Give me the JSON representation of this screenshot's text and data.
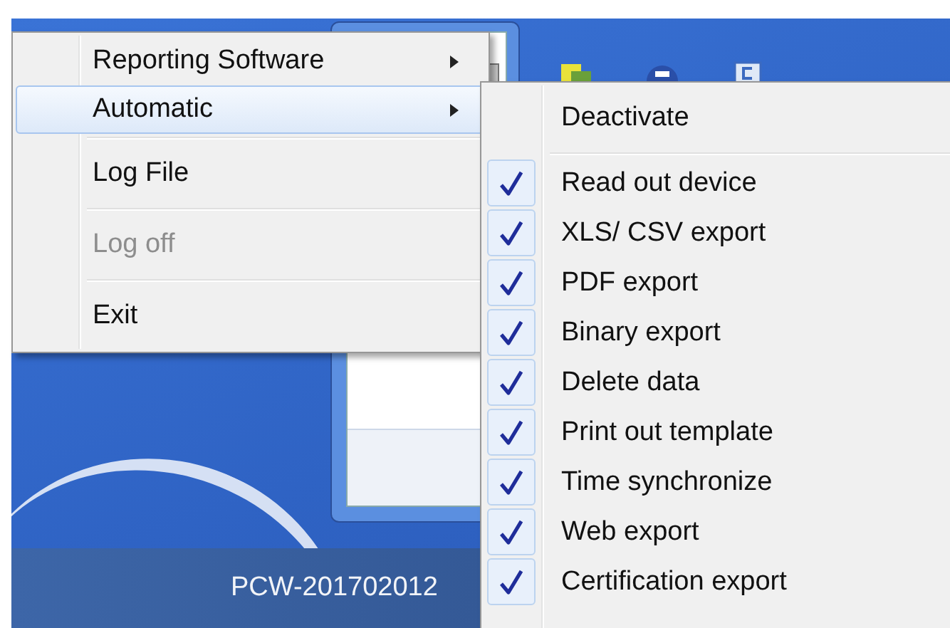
{
  "taskbar": {
    "computer_name": "PCW-201702012"
  },
  "context_menu": {
    "items": [
      {
        "kind": "submenu",
        "label": "Reporting Software",
        "selected": false,
        "disabled": false
      },
      {
        "kind": "submenu",
        "label": "Automatic",
        "selected": true,
        "disabled": false
      },
      {
        "kind": "separator"
      },
      {
        "kind": "command",
        "label": "Log File",
        "selected": false,
        "disabled": false
      },
      {
        "kind": "separator"
      },
      {
        "kind": "command",
        "label": "Log off",
        "selected": false,
        "disabled": true
      },
      {
        "kind": "separator"
      },
      {
        "kind": "command",
        "label": "Exit",
        "selected": false,
        "disabled": false
      }
    ]
  },
  "submenu": {
    "items": [
      {
        "kind": "command",
        "label": "Deactivate",
        "checked": false
      },
      {
        "kind": "separator"
      },
      {
        "kind": "command",
        "label": "Read out device",
        "checked": true
      },
      {
        "kind": "command",
        "label": "XLS/ CSV export",
        "checked": true
      },
      {
        "kind": "command",
        "label": "PDF export",
        "checked": true
      },
      {
        "kind": "command",
        "label": "Binary export",
        "checked": true
      },
      {
        "kind": "command",
        "label": "Delete data",
        "checked": true
      },
      {
        "kind": "command",
        "label": "Print out template",
        "checked": true
      },
      {
        "kind": "command",
        "label": "Time synchronize",
        "checked": true
      },
      {
        "kind": "command",
        "label": "Web export",
        "checked": true
      },
      {
        "kind": "command",
        "label": "Certification export",
        "checked": true
      }
    ]
  }
}
